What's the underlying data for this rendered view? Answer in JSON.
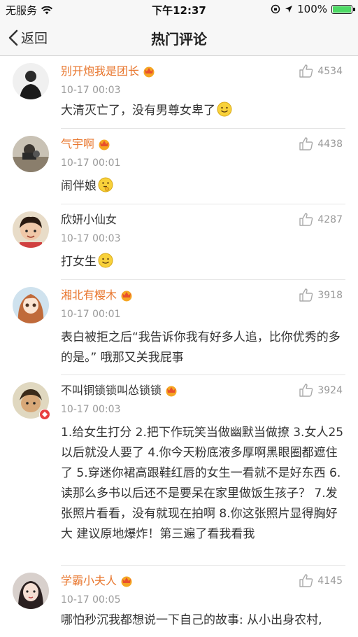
{
  "status_bar": {
    "carrier": "无服务",
    "time": "下午12:37",
    "battery": "100%"
  },
  "nav": {
    "back_label": "返回",
    "title": "热门评论"
  },
  "comments": [
    {
      "username": "别开炮我是团长",
      "timestamp": "10-17 00:03",
      "likes": "4534",
      "text": "大清灭亡了，没有男尊女卑了"
    },
    {
      "username": "气宇啊",
      "timestamp": "10-17 00:01",
      "likes": "4438",
      "text": "闹伴娘"
    },
    {
      "username": "欣妍小仙女",
      "timestamp": "10-17 00:03",
      "likes": "4287",
      "text": "打女生"
    },
    {
      "username": "湘北有樱木",
      "timestamp": "10-17 00:01",
      "likes": "3918",
      "text": "表白被拒之后“我告诉你我有好多人追，比你优秀的多的是。”   哦那又关我屁事"
    },
    {
      "username": "不叫铜锁锁叫怂锁锁",
      "timestamp": "10-17 00:03",
      "likes": "3924",
      "text": "1.给女生打分 2.把下作玩笑当做幽默当做撩 3.女人25以后就没人要了 4.你今天粉底液多厚啊黑眼圈都遮住了 5.穿迷你裙高跟鞋红唇的女生一看就不是好东西 6.读那么多书以后还不是要呆在家里做饭生孩子？ 7.发张照片看看，没有就现在拍啊 8.你这张照片显得胸好大 建议原地爆炸！第三遍了看我看我"
    },
    {
      "username": "学霸小夫人",
      "timestamp": "10-17 00:05",
      "likes": "4145",
      "text": "哪怕秒沉我都想说一下自己的故事: 从小出身农村,"
    }
  ],
  "icons": {
    "back": "chevron-left-icon",
    "wifi": "wifi-icon",
    "like": "thumbs-up-icon",
    "vip": "vip-crown-icon",
    "emoji_smile": "smile-emoji-icon",
    "emoji_thinking": "thinking-emoji-icon"
  },
  "colors": {
    "username_highlight": "#e8762d",
    "timestamp": "#999999",
    "battery": "#4cd964"
  }
}
